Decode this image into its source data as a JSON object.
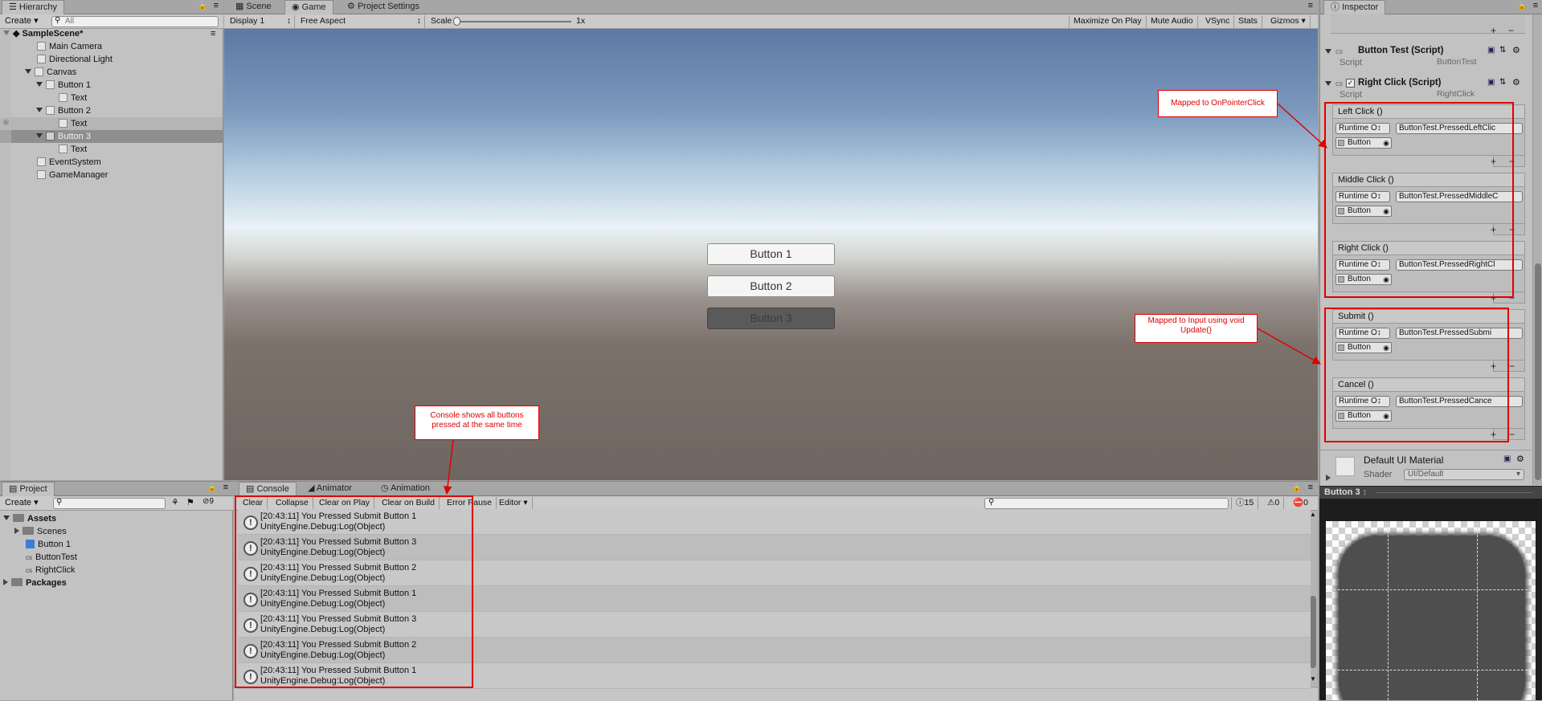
{
  "hierarchy": {
    "tab_label": "Hierarchy",
    "create_label": "Create",
    "search_placeholder": "All",
    "scene_name": "SampleScene*",
    "items": [
      {
        "label": "Main Camera"
      },
      {
        "label": "Directional Light"
      },
      {
        "label": "Canvas"
      },
      {
        "label": "Button 1"
      },
      {
        "label": "Text"
      },
      {
        "label": "Button 2"
      },
      {
        "label": "Text"
      },
      {
        "label": "Button 3"
      },
      {
        "label": "Text"
      },
      {
        "label": "EventSystem"
      },
      {
        "label": "GameManager"
      }
    ]
  },
  "center_tabs": [
    {
      "label": "Scene"
    },
    {
      "label": "Game"
    },
    {
      "label": "Project Settings"
    }
  ],
  "game_toolbar": {
    "display": "Display 1",
    "aspect": "Free Aspect",
    "scale_label": "Scale",
    "scale_value": "1x",
    "maximize": "Maximize On Play",
    "mute": "Mute Audio",
    "vsync": "VSync",
    "stats": "Stats",
    "gizmos": "Gizmos"
  },
  "game_view": {
    "buttons": [
      "Button 1",
      "Button 2",
      "Button 3"
    ]
  },
  "inspector": {
    "tab_label": "Inspector",
    "button_test": {
      "title": "Button Test (Script)",
      "script_label": "Script",
      "script_value": "ButtonTest"
    },
    "right_click": {
      "title": "Right Click (Script)",
      "script_label": "Script",
      "script_value": "RightClick"
    },
    "events": [
      {
        "name": "Left Click ()",
        "runtime": "Runtime O↕",
        "function": "ButtonTest.PressedLeftClic",
        "object": "Button"
      },
      {
        "name": "Middle Click ()",
        "runtime": "Runtime O↕",
        "function": "ButtonTest.PressedMiddleC",
        "object": "Button"
      },
      {
        "name": "Right Click ()",
        "runtime": "Runtime O↕",
        "function": "ButtonTest.PressedRightCl",
        "object": "Button"
      },
      {
        "name": "Submit ()",
        "runtime": "Runtime O↕",
        "function": "ButtonTest.PressedSubmi",
        "object": "Button"
      },
      {
        "name": "Cancel ()",
        "runtime": "Runtime O↕",
        "function": "ButtonTest.PressedCance",
        "object": "Button"
      }
    ],
    "material": {
      "name": "Default UI Material",
      "shader_label": "Shader",
      "shader_value": "UI/Default"
    },
    "preview_label": "Button 3"
  },
  "project": {
    "tab_label": "Project",
    "create_label": "Create",
    "hidden_count": "9",
    "assets_label": "Assets",
    "items": [
      {
        "label": "Scenes"
      },
      {
        "label": "Button 1"
      },
      {
        "label": "ButtonTest"
      },
      {
        "label": "RightClick"
      }
    ],
    "packages_label": "Packages"
  },
  "console_tabs": [
    {
      "label": "Console"
    },
    {
      "label": "Animator"
    },
    {
      "label": "Animation"
    }
  ],
  "console_toolbar": {
    "clear": "Clear",
    "collapse": "Collapse",
    "clear_on_play": "Clear on Play",
    "clear_on_build": "Clear on Build",
    "error_pause": "Error Pause",
    "editor": "Editor",
    "count_logs": "15",
    "count_warnings": "0",
    "count_errors": "0"
  },
  "console_entries": [
    {
      "line1": "[20:43:11] You Pressed Submit Button 1",
      "line2": "UnityEngine.Debug:Log(Object)"
    },
    {
      "line1": "[20:43:11] You Pressed Submit Button 3",
      "line2": "UnityEngine.Debug:Log(Object)"
    },
    {
      "line1": "[20:43:11] You Pressed Submit Button 2",
      "line2": "UnityEngine.Debug:Log(Object)"
    },
    {
      "line1": "[20:43:11] You Pressed Submit Button 1",
      "line2": "UnityEngine.Debug:Log(Object)"
    },
    {
      "line1": "[20:43:11] You Pressed Submit Button 3",
      "line2": "UnityEngine.Debug:Log(Object)"
    },
    {
      "line1": "[20:43:11] You Pressed Submit Button 2",
      "line2": "UnityEngine.Debug:Log(Object)"
    },
    {
      "line1": "[20:43:11] You Pressed Submit Button 1",
      "line2": "UnityEngine.Debug:Log(Object)"
    }
  ],
  "annotations": {
    "pointer_click": "Mapped to OnPointerClick",
    "input_update": "Mapped to Input using void Update()",
    "console_note": "Console shows all buttons pressed at the same time"
  }
}
